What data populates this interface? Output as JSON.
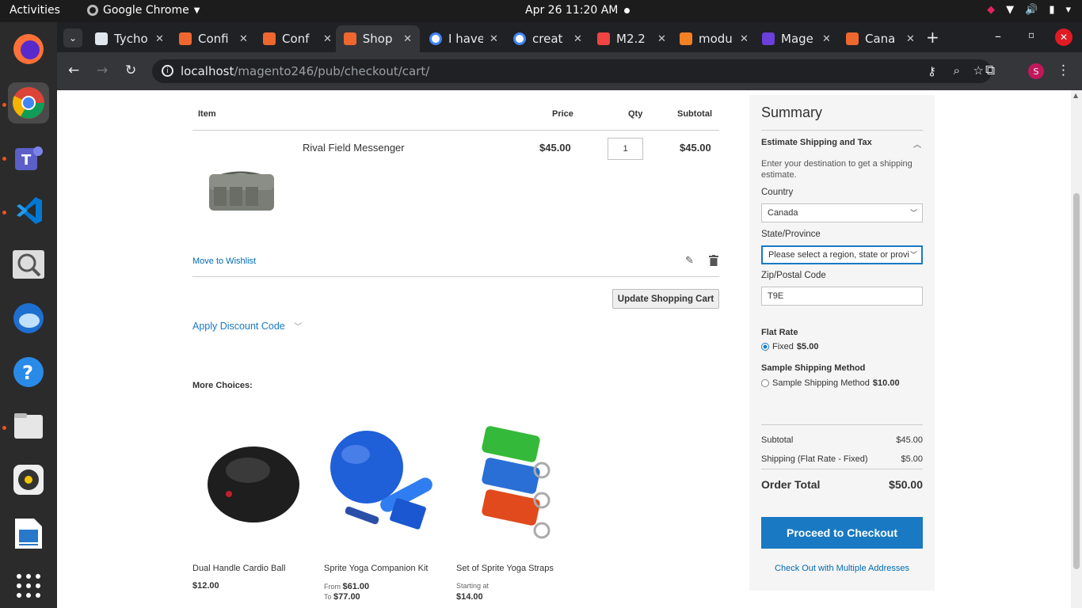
{
  "os": {
    "activities": "Activities",
    "app_name": "Google Chrome",
    "clock": "Apr 26  11:20 AM"
  },
  "tabs": [
    "Tycho",
    "Confi",
    "Conf",
    "Shop",
    "I have",
    "creat",
    "M2.2",
    "modu",
    "Mage",
    "Cana"
  ],
  "url": {
    "host": "localhost",
    "path": "/magento246/pub/checkout/cart/"
  },
  "cart": {
    "headers": {
      "item": "Item",
      "price": "Price",
      "qty": "Qty",
      "subtotal": "Subtotal"
    },
    "item": {
      "name": "Rival Field Messenger",
      "price": "$45.00",
      "qty": "1",
      "subtotal": "$45.00"
    },
    "move_to_wishlist": "Move to Wishlist",
    "update_button": "Update Shopping Cart",
    "discount": "Apply Discount Code"
  },
  "more_choices": {
    "title": "More Choices:",
    "products": [
      {
        "name": "Dual Handle Cardio Ball",
        "price": "$12.00"
      },
      {
        "name": "Sprite Yoga Companion Kit",
        "from_label": "From",
        "from_price": "$61.00",
        "to_label": "To",
        "to_price": "$77.00"
      },
      {
        "name": "Set of Sprite Yoga Straps",
        "starting_label": "Starting at",
        "price": "$14.00"
      }
    ]
  },
  "summary": {
    "title": "Summary",
    "estimate_title": "Estimate Shipping and Tax",
    "estimate_desc": "Enter your destination to get a shipping estimate.",
    "country_label": "Country",
    "country_value": "Canada",
    "state_label": "State/Province",
    "state_value": "Please select a region, state or province.",
    "zip_label": "Zip/Postal Code",
    "zip_value": "T9E",
    "flat_rate_title": "Flat Rate",
    "flat_rate_option": "Fixed",
    "flat_rate_price": "$5.00",
    "sample_title": "Sample Shipping Method",
    "sample_option": "Sample Shipping Method",
    "sample_price": "$10.00",
    "subtotal_label": "Subtotal",
    "subtotal_value": "$45.00",
    "shipping_label": "Shipping (Flat Rate - Fixed)",
    "shipping_value": "$5.00",
    "total_label": "Order Total",
    "total_value": "$50.00",
    "checkout_button": "Proceed to Checkout",
    "multi_address": "Check Out with Multiple Addresses"
  },
  "colors": {
    "accent": "#1979c3",
    "link": "#006bb4"
  }
}
